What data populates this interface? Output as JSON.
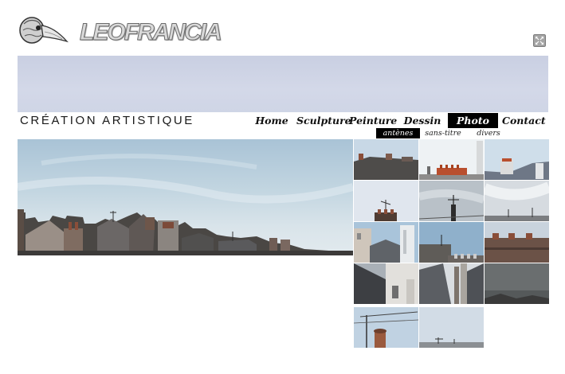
{
  "header": {
    "logo_text": "LEOFRANCIA",
    "tagline": "CRÉATION ARTISTIQUE"
  },
  "nav": {
    "items": [
      {
        "label": "Home",
        "active": false
      },
      {
        "label": "Sculpture",
        "active": false
      },
      {
        "label": "Peinture",
        "active": false
      },
      {
        "label": "Dessin",
        "active": false
      },
      {
        "label": "Photo",
        "active": true
      },
      {
        "label": "Contact",
        "active": false
      }
    ]
  },
  "subnav": {
    "items": [
      {
        "label": "antènes",
        "active": true
      },
      {
        "label": "sans-titre",
        "active": false
      },
      {
        "label": "divers",
        "active": false
      }
    ]
  },
  "gallery": {
    "thumbnail_count": 14
  },
  "colors": {
    "banner": "#cdd3e5",
    "active_nav_bg": "#000000",
    "text": "#111111"
  },
  "icons": {
    "fullscreen": "fullscreen-icon",
    "logo": "mask-logo-icon"
  }
}
